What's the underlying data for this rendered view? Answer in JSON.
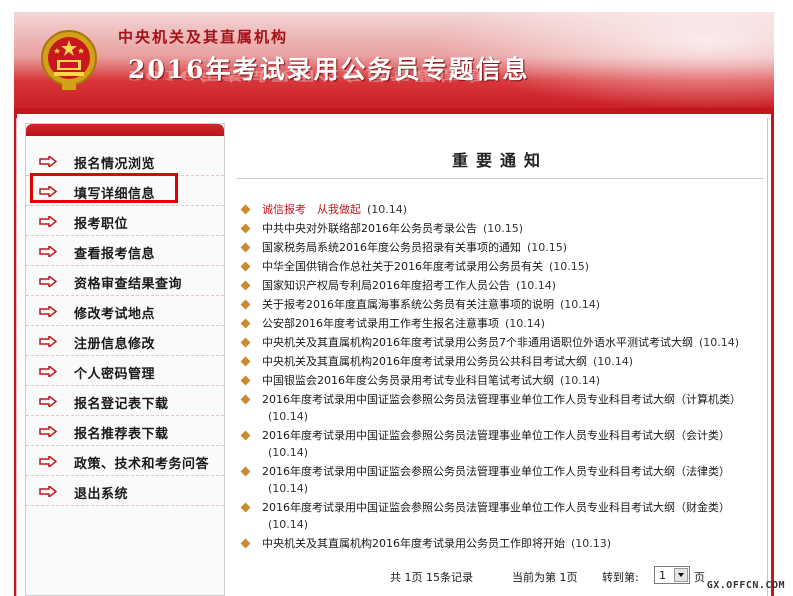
{
  "banner": {
    "subtitle": "中央机关及其直属机构",
    "title": "2016年考试录用公务员专题信息"
  },
  "sidebar": {
    "items": [
      {
        "label": "报名情况浏览"
      },
      {
        "label": "填写详细信息"
      },
      {
        "label": "报考职位"
      },
      {
        "label": "查看报考信息"
      },
      {
        "label": "资格审查结果查询"
      },
      {
        "label": "修改考试地点"
      },
      {
        "label": "注册信息修改"
      },
      {
        "label": "个人密码管理"
      },
      {
        "label": "报名登记表下载"
      },
      {
        "label": "报名推荐表下载"
      },
      {
        "label": "政策、技术和考务问答"
      },
      {
        "label": "退出系统"
      }
    ],
    "highlighted_index": 1
  },
  "main": {
    "title": "重要通知",
    "notices": [
      {
        "title": "诚信报考　从我做起",
        "date": "(10.14)",
        "hot": true
      },
      {
        "title": "中共中央对外联络部2016年公务员考录公告",
        "date": "(10.15)"
      },
      {
        "title": "国家税务局系统2016年度公务员招录有关事项的通知",
        "date": "(10.15)"
      },
      {
        "title": "中华全国供销合作总社关于2016年度考试录用公务员有关",
        "date": "(10.15)"
      },
      {
        "title": "国家知识产权局专利局2016年度招考工作人员公告",
        "date": "(10.14)"
      },
      {
        "title": "关于报考2016年度直属海事系统公务员有关注意事项的说明",
        "date": "(10.14)"
      },
      {
        "title": "公安部2016年度考试录用工作考生报名注意事项",
        "date": "(10.14)"
      },
      {
        "title": "中央机关及其直属机构2016年度考试录用公务员7个非通用语职位外语水平测试考试大纲",
        "date": "(10.14)",
        "wrap": true
      },
      {
        "title": "中央机关及其直属机构2016年度考试录用公务员公共科目考试大纲",
        "date": "(10.14)"
      },
      {
        "title": "中国银监会2016年度公务员录用考试专业科目笔试考试大纲",
        "date": "(10.14)"
      },
      {
        "title": "2016年度考试录用中国证监会参照公务员法管理事业单位工作人员专业科目考试大纲（计算机类）",
        "date": "(10.14)",
        "wrap": true
      },
      {
        "title": "2016年度考试录用中国证监会参照公务员法管理事业单位工作人员专业科目考试大纲（会计类）",
        "date": "(10.14)",
        "wrap": true
      },
      {
        "title": "2016年度考试录用中国证监会参照公务员法管理事业单位工作人员专业科目考试大纲（法律类）",
        "date": "(10.14)",
        "wrap": true
      },
      {
        "title": "2016年度考试录用中国证监会参照公务员法管理事业单位工作人员专业科目考试大纲（财金类）",
        "date": "(10.14)",
        "wrap": true
      },
      {
        "title": "中央机关及其直属机构2016年度考试录用公务员工作即将开始",
        "date": "(10.13)"
      }
    ]
  },
  "pager": {
    "total": "共 1页 15条记录",
    "current": "当前为第 1页",
    "goto_label": "转到第:",
    "selected_page": "1",
    "suffix": "页"
  },
  "watermark": "GX.OFFCN.COM",
  "colors": {
    "brand_red": "#c3151c",
    "highlight_red": "#e00000",
    "hot_text": "#c8171d",
    "bullet": "#cc8a2f"
  }
}
